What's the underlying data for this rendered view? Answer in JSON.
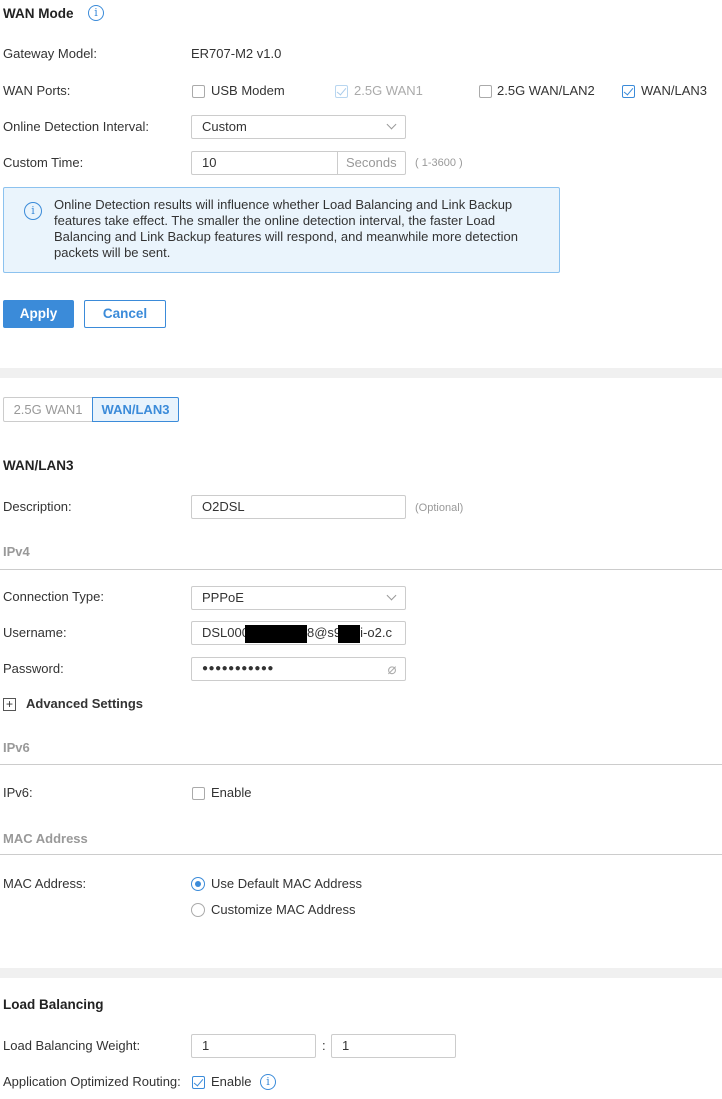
{
  "wan_mode": {
    "title": "WAN Mode",
    "gateway_label": "Gateway Model:",
    "gateway_value": "ER707-M2 v1.0",
    "ports_label": "WAN Ports:",
    "ports": [
      {
        "label": "USB Modem",
        "checked": false
      },
      {
        "label": "2.5G WAN1",
        "checked": true,
        "disabled": true
      },
      {
        "label": "2.5G WAN/LAN2",
        "checked": false
      },
      {
        "label": "WAN/LAN3",
        "checked": true
      }
    ],
    "interval_label": "Online Detection Interval:",
    "interval_value": "Custom",
    "custom_time_label": "Custom Time:",
    "custom_time_value": "10",
    "custom_time_unit": "Seconds",
    "custom_time_range": "( 1-3600 )",
    "info_text": "Online Detection results will influence whether Load Balancing and Link Backup features take effect. The smaller the online detection interval, the faster Load Balancing and Link Backup features will respond, and meanwhile more detection packets will be sent.",
    "apply": "Apply",
    "cancel": "Cancel"
  },
  "tabs": [
    {
      "label": "2.5G WAN1",
      "active": false
    },
    {
      "label": "WAN/LAN3",
      "active": true
    }
  ],
  "port": {
    "title": "WAN/LAN3",
    "description_label": "Description:",
    "description_value": "O2DSL",
    "optional": "(Optional)",
    "ipv4_section": "IPv4",
    "conn_label": "Connection Type:",
    "conn_value": "PPPoE",
    "username_label": "Username:",
    "username_parts": [
      "DSL000",
      "8@s9",
      "i-o2.c"
    ],
    "password_label": "Password:",
    "password_value": "●●●●●●●●●●●",
    "advanced": "Advanced Settings",
    "ipv6_section": "IPv6",
    "ipv6_label": "IPv6:",
    "ipv6_enable": "Enable",
    "mac_section": "MAC Address",
    "mac_label": "MAC Address:",
    "mac_options": [
      {
        "label": "Use Default MAC Address",
        "selected": true
      },
      {
        "label": "Customize MAC Address",
        "selected": false
      }
    ]
  },
  "load_balancing": {
    "title": "Load Balancing",
    "weight_label": "Load Balancing Weight:",
    "weight_1": "1",
    "separator": ":",
    "weight_2": "1",
    "aor_label": "Application Optimized Routing:",
    "aor_enable": "Enable",
    "aor_checked": true
  },
  "colors": {
    "accent": "#3b8bd9",
    "info_bg": "#eaf4fc"
  }
}
